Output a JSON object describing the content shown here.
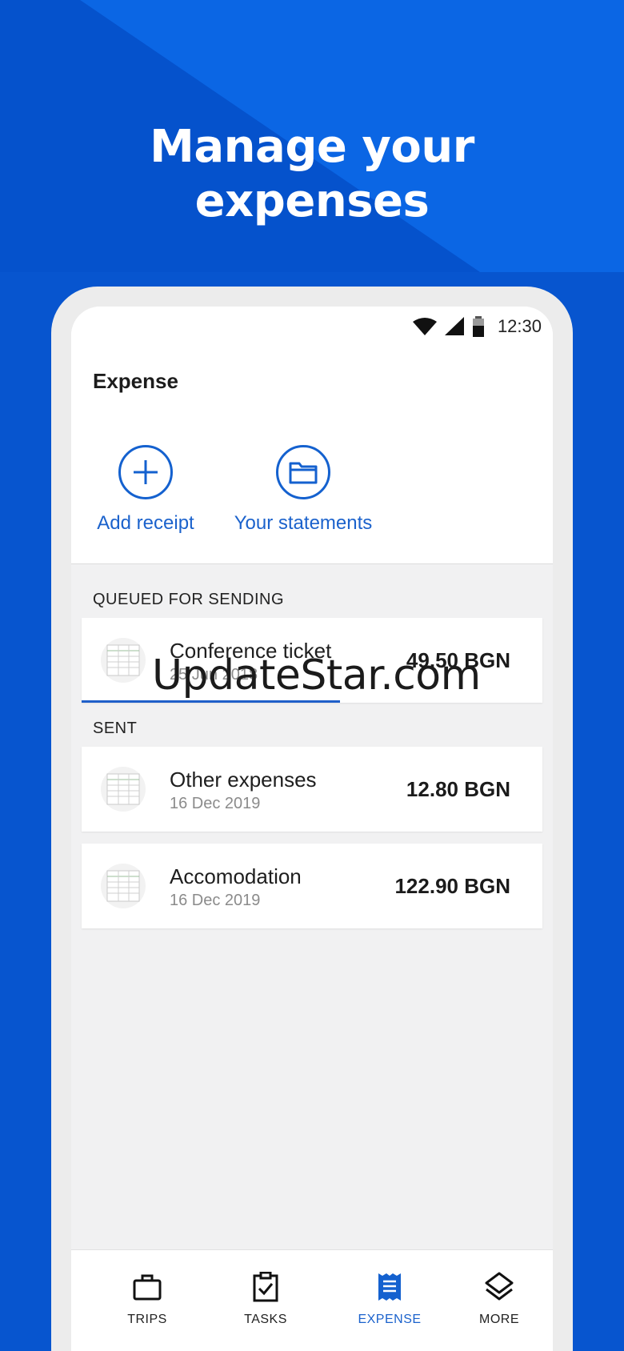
{
  "headline": {
    "line1": "Manage your",
    "line2": "expenses"
  },
  "status_bar": {
    "time": "12:30"
  },
  "screen": {
    "title": "Expense"
  },
  "actions": {
    "add_receipt": "Add receipt",
    "your_statements": "Your statements"
  },
  "queued": {
    "heading": "QUEUED FOR SENDING",
    "items": [
      {
        "name": "Conference ticket",
        "date": "25 Jun 2018",
        "amount": "49.50 BGN",
        "upload_progress": 0.56
      }
    ]
  },
  "sent": {
    "heading": "SENT",
    "items": [
      {
        "name": "Other expenses",
        "date": "16 Dec 2019",
        "amount": "12.80 BGN"
      },
      {
        "name": "Accomodation",
        "date": "16 Dec 2019",
        "amount": "122.90 BGN"
      }
    ]
  },
  "watermark": "UpdateStar.com",
  "bottom_nav": [
    {
      "label": "TRIPS",
      "icon": "briefcase-icon",
      "active": false
    },
    {
      "label": "TASKS",
      "icon": "clipboard-check-icon",
      "active": false
    },
    {
      "label": "EXPENSE",
      "icon": "receipt-icon",
      "active": true
    },
    {
      "label": "MORE",
      "icon": "layers-icon",
      "active": false
    }
  ],
  "colors": {
    "background": "#0755cf",
    "accent": "#1b62cc",
    "white": "#ffffff"
  }
}
